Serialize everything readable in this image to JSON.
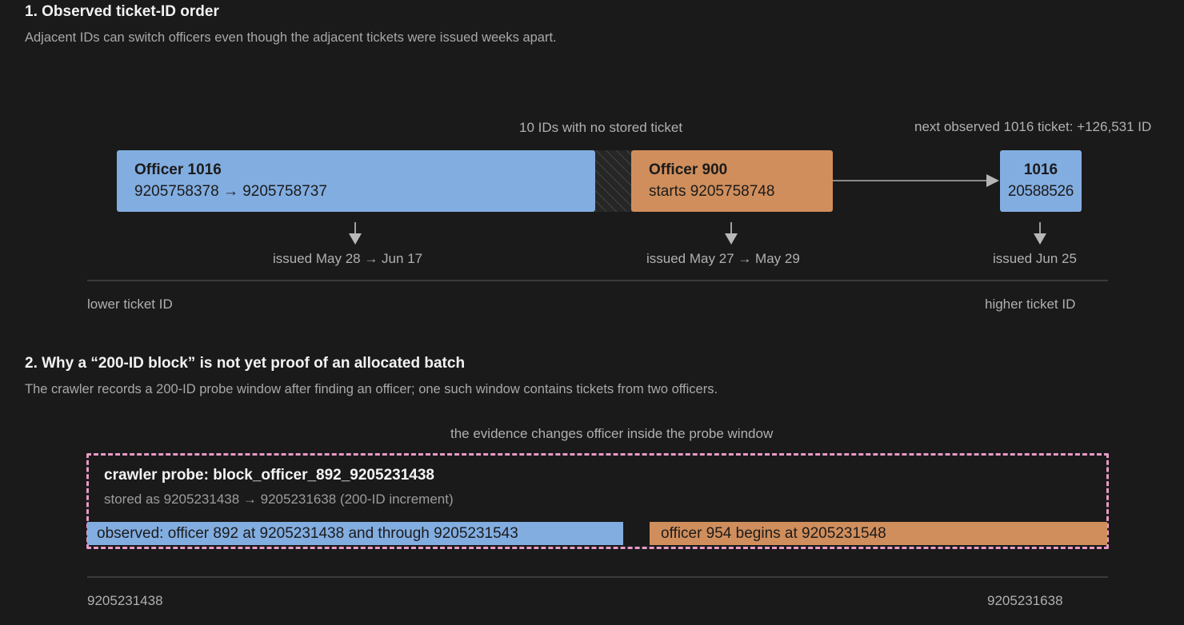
{
  "section1": {
    "title": "1. Observed ticket-ID order",
    "subtitle": "Adjacent IDs can switch officers even though the adjacent tickets were issued weeks apart.",
    "gap_label": "10 IDs with no stored ticket",
    "next_label": "next observed 1016 ticket: +126,531 ID",
    "box_a": {
      "title": "Officer 1016",
      "range": "9205758378 → 9205758737",
      "issued": "issued May 28 → Jun 17",
      "color": "#82ade0"
    },
    "box_b": {
      "title": "Officer 900",
      "range": "starts 9205758748",
      "issued": "issued May 27 → May 29",
      "color": "#d08e5c"
    },
    "box_c": {
      "title": "1016",
      "range": "20588526",
      "issued": "issued Jun 25",
      "color": "#82ade0"
    },
    "axis_left": "lower ticket ID",
    "axis_right": "higher ticket ID"
  },
  "section2": {
    "title": "2. Why a “200-ID block” is not yet proof of an allocated batch",
    "subtitle": "The crawler records a 200-ID probe window after finding an officer; one such window contains tickets from two officers.",
    "note": "the evidence changes officer inside the probe window",
    "probe_title": "crawler probe: block_officer_892_9205231438",
    "probe_sub": "stored as 9205231438 → 9205231638 (200-ID increment)",
    "bar_a": "observed: officer 892 at 9205231438 and through 9205231543",
    "bar_b": "officer 954 begins at 9205231548",
    "axis_left": "9205231438",
    "axis_right": "9205231638",
    "probe_color": "#e89ac5"
  }
}
